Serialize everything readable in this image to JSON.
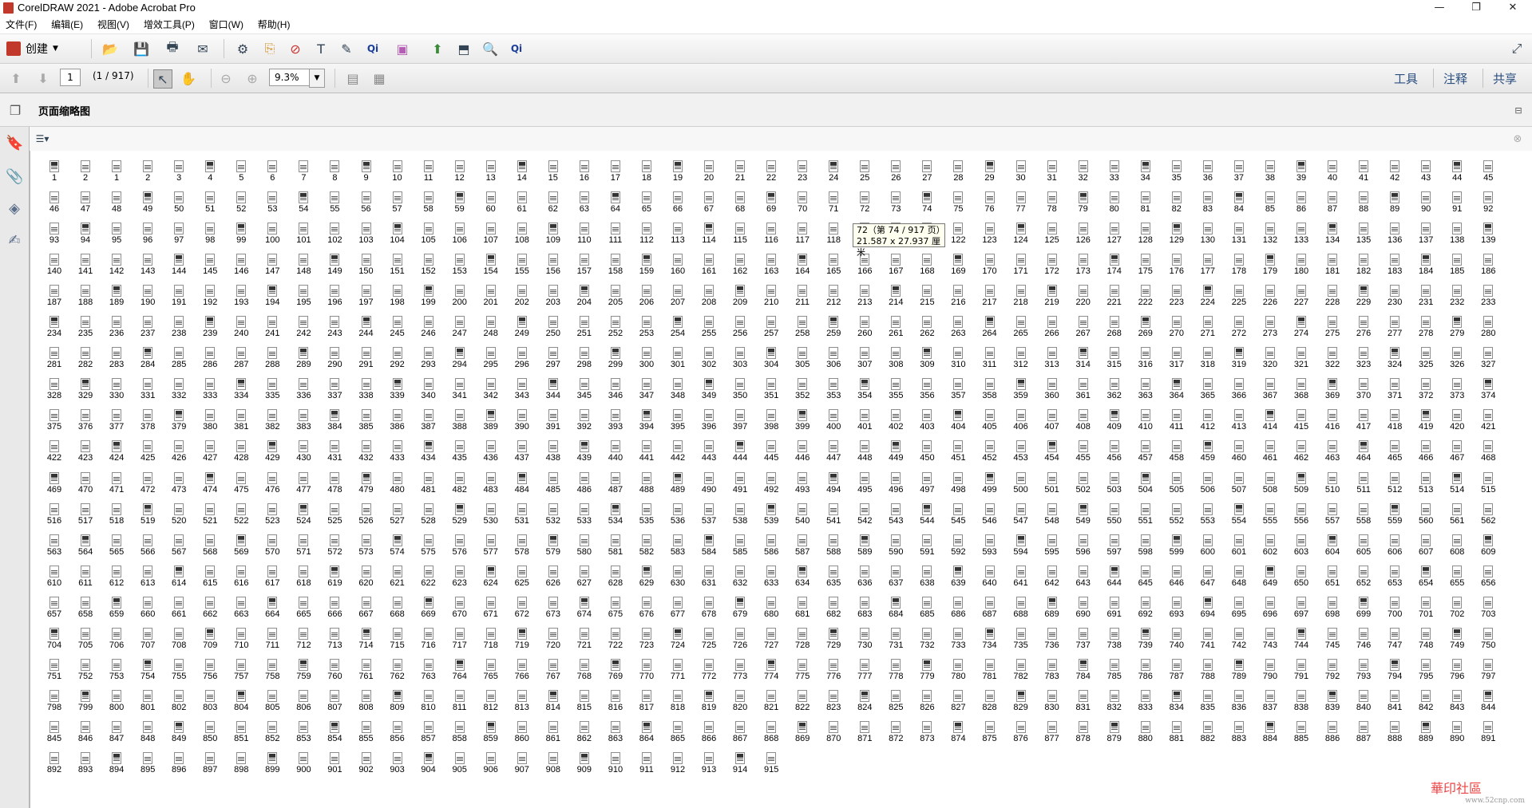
{
  "window": {
    "title": "CorelDRAW 2021 - Adobe Acrobat Pro",
    "minimize": "—",
    "restore": "❐",
    "close": "✕"
  },
  "menu": [
    "文件(F)",
    "编辑(E)",
    "视图(V)",
    "增效工具(P)",
    "窗口(W)",
    "帮助(H)"
  ],
  "toolbar": {
    "create_label": "创建"
  },
  "nav": {
    "page_value": "1",
    "page_count": "(1 / 917)",
    "zoom_value": "9.3%"
  },
  "right_tabs": [
    "工具",
    "注释",
    "共享"
  ],
  "panel": {
    "title": "页面缩略图"
  },
  "thumbnail_labels": [
    1,
    2,
    1,
    2,
    3,
    4,
    5,
    6,
    7,
    8,
    9,
    10,
    11,
    12,
    13,
    14,
    15,
    16,
    17,
    18,
    19,
    20,
    21,
    22,
    23,
    24,
    25,
    26,
    27,
    28,
    29,
    30,
    31,
    32,
    33,
    34,
    35,
    36,
    37,
    38,
    39,
    40,
    41,
    42,
    43,
    44,
    45
  ],
  "thumbnail_last": 915,
  "tooltip": {
    "line1": "72（第 74 / 917 页）",
    "line2": "21.587 x 27.937 厘米"
  },
  "watermark": {
    "text": "華印社區",
    "sub": "www.52cnp.com"
  },
  "colors": {
    "link_blue": "#2b4f80",
    "accent_red": "#c0392b"
  }
}
